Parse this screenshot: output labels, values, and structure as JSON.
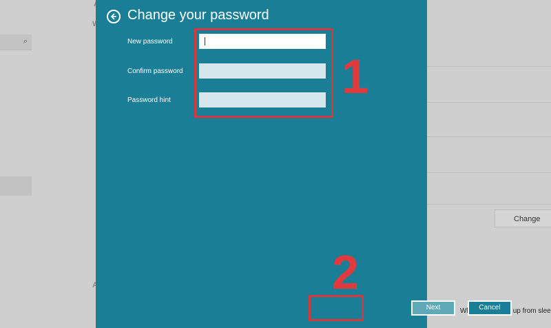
{
  "dialog": {
    "title": "Change your password",
    "fields": [
      {
        "label": "New password",
        "value": ""
      },
      {
        "label": "Confirm password",
        "value": ""
      },
      {
        "label": "Password hint",
        "value": ""
      }
    ],
    "buttons": {
      "next_label": "Next",
      "cancel_label": "Cancel"
    }
  },
  "annotations": {
    "step1": "1",
    "step2": "2"
  },
  "background": {
    "change_button_label": "Change",
    "sleep_text": "When PC wakes up from sleep"
  },
  "colors": {
    "dialog_bg": "#1a7f96",
    "annotation_red": "#d6393d"
  },
  "icons": {
    "back": "back-arrow-circle-icon",
    "search": "search-icon"
  }
}
